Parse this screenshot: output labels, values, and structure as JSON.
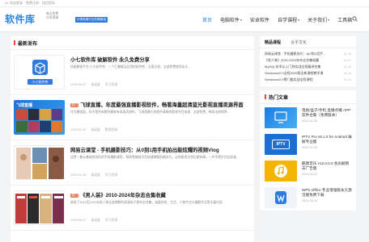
{
  "topbar": {
    "links": [
      "Hi, 欢迎登录",
      "免费注册",
      "找回密码"
    ]
  },
  "header": {
    "logo": "软件库",
    "slogan_lines": [
      "每天免费",
      "分享资源"
    ],
    "slogan_pill": "分享资源行业先锋原创",
    "nav": [
      {
        "label": "首页",
        "active": true,
        "dropdown": false
      },
      {
        "label": "电脑软件",
        "active": false,
        "dropdown": true
      },
      {
        "label": "安卓软件",
        "active": false,
        "dropdown": false
      },
      {
        "label": "自学课程",
        "active": false,
        "dropdown": true
      },
      {
        "label": "关于我们",
        "active": false,
        "dropdown": true
      },
      {
        "label": "工具箱",
        "active": false,
        "dropdown": false
      }
    ],
    "search_icon": "search-icon"
  },
  "main": {
    "section_title": "最新发布",
    "articles": [
      {
        "tag": "",
        "title": "小七软件库 破解软件 永久免费分享",
        "excerpt": "技能解锁平台 小七软件库：一个汇集精品应用的软件库，无需注册，全部免费使用永久...",
        "date": "2025-09-07",
        "views": "阅读量",
        "category": "学习资源",
        "thumb_caption": "小七软件库"
      },
      {
        "tag": "热门",
        "title": "飞球直播，年度最强直播影视软件，畅看海量超清蓝光影视直播资源界面",
        "excerpt": "作为最强直，但不是所有影院都能有高清资源的，飞球直播为你提供清晰的影视节目来源，全部免费，畅享全屏视界...",
        "date": "2025-02-20",
        "views": "阅读量",
        "category": "影视资源",
        "thumb_caption": "飞球直播"
      },
      {
        "tag": "",
        "title": "网易云课堂 - 手机摄影技巧：从0到1用手机拍出能炫耀的视频Vlog",
        "excerpt": "这是一套从基础到进阶的手机摄影课程，帮助零基础学员快速掌握拍摄技巧，从构图用光到后期剪辑，一步步提升作品质量...",
        "date": "2025-01-09",
        "views": "阅读量",
        "category": "学习资源",
        "thumb_caption": ""
      },
      {
        "tag": "热门",
        "title": "《男人装》2010-2024年杂志合集收藏",
        "excerpt": "收录了2010至2024年男人装全部期数的高清电子版杂志合集，涵盖时尚、生活、人物专访与摄影作品等丰富内容...",
        "date": "2025-03-07",
        "views": "阅读量",
        "category": "学习资源",
        "thumb_caption": ""
      }
    ]
  },
  "sidebar": {
    "tabs": [
      "精品课程",
      "合乎文化"
    ],
    "list": [
      {
        "title": "网易云课堂 - 手机摄影技巧：从0到1用手...",
        "date": "01-09"
      },
      {
        "title": "《男人装》2010-2024年杂志合集收藏",
        "date": "03-07"
      },
      {
        "title": "MySQL技术从入门到实战全程精讲合集",
        "date": "02-15"
      },
      {
        "title": "Seedance2.0全程2025版全新课程教学课",
        "date": "02-12"
      },
      {
        "title": "Seedance2.0零门槛实战全程课程",
        "date": "01-21"
      }
    ],
    "hot_title": "热门文章",
    "hot": [
      {
        "title": "电视/盒子/手机 直播点播 APP 软件合集（免费版本）",
        "date": "2025-01-30",
        "thumb": "tv-app"
      },
      {
        "title": "IPTV Pro v8.1.0 for Android 破解专业版",
        "date": "2024-11-04",
        "thumb": "IPTV"
      },
      {
        "title": "酷我音乐 v12.0.0.0 会员解锁去广告版",
        "date": "2024-06-21",
        "thumb": "music"
      },
      {
        "title": "WPS Office 专业增强版永久激活版免费下载",
        "date": "2024-05-12",
        "thumb": "wps"
      }
    ]
  },
  "colors": {
    "brand": "#2a83e0",
    "tag": "#f07b5b",
    "section_bar": "#e54d42"
  }
}
